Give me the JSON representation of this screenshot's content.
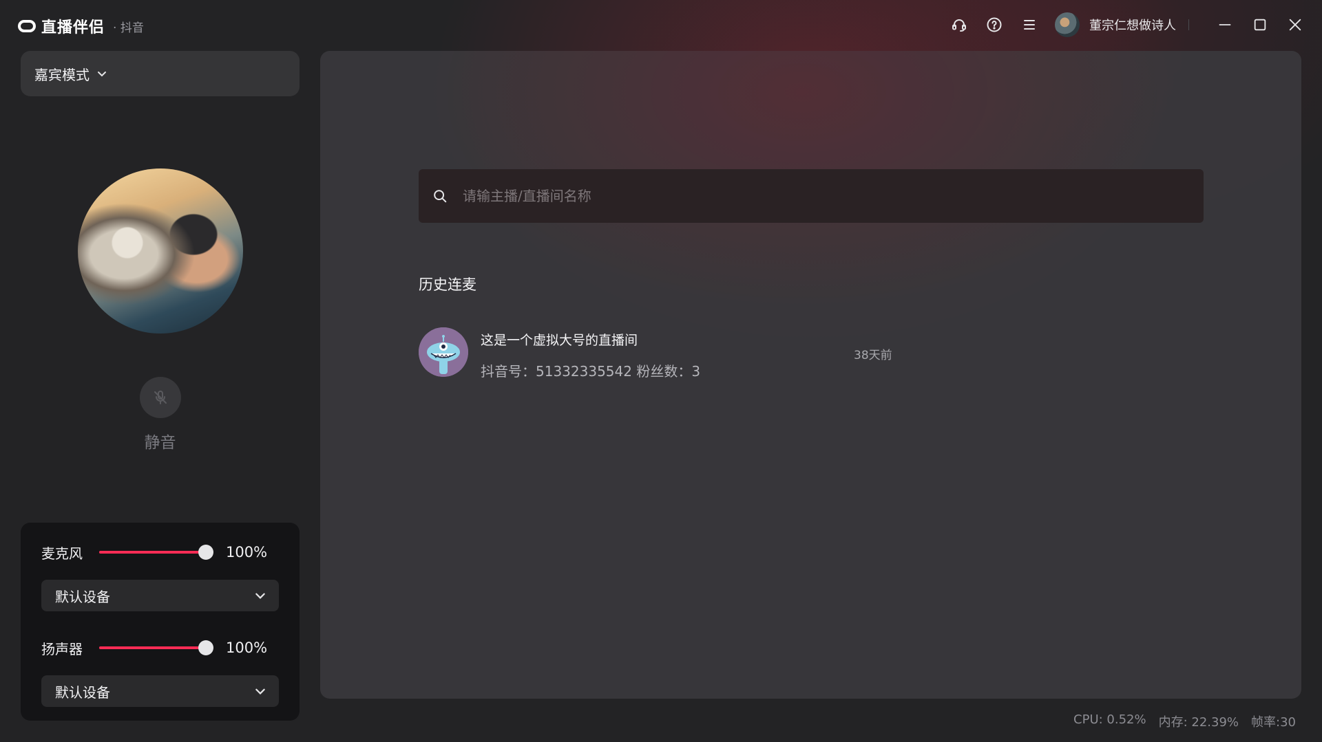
{
  "app": {
    "name": "直播伴侣",
    "platform": "· 抖音"
  },
  "user": {
    "name": "董宗仁想做诗人"
  },
  "titlebar_icons": [
    "headset-icon",
    "help-icon",
    "menu-icon"
  ],
  "left_panel": {
    "mode_label": "嘉宾模式",
    "mute_label": "静音",
    "microphone": {
      "label": "麦克风",
      "volume": 100,
      "volume_text": "100%",
      "device": "默认设备"
    },
    "speaker": {
      "label": "扬声器",
      "volume": 100,
      "volume_text": "100%",
      "device": "默认设备"
    }
  },
  "main": {
    "search_placeholder": "请输主播/直播间名称",
    "history_title": "历史连麦",
    "history": [
      {
        "name": "这是一个虚拟大号的直播间",
        "meta": "抖音号：51332335542 粉丝数：3",
        "time": "38天前"
      }
    ]
  },
  "status": {
    "cpu": "CPU: 0.52%",
    "memory": "内存: 22.39%",
    "fps": "帧率:30"
  },
  "colors": {
    "accent": "#fe2c55",
    "background": "#232325",
    "panel": "#141416"
  }
}
